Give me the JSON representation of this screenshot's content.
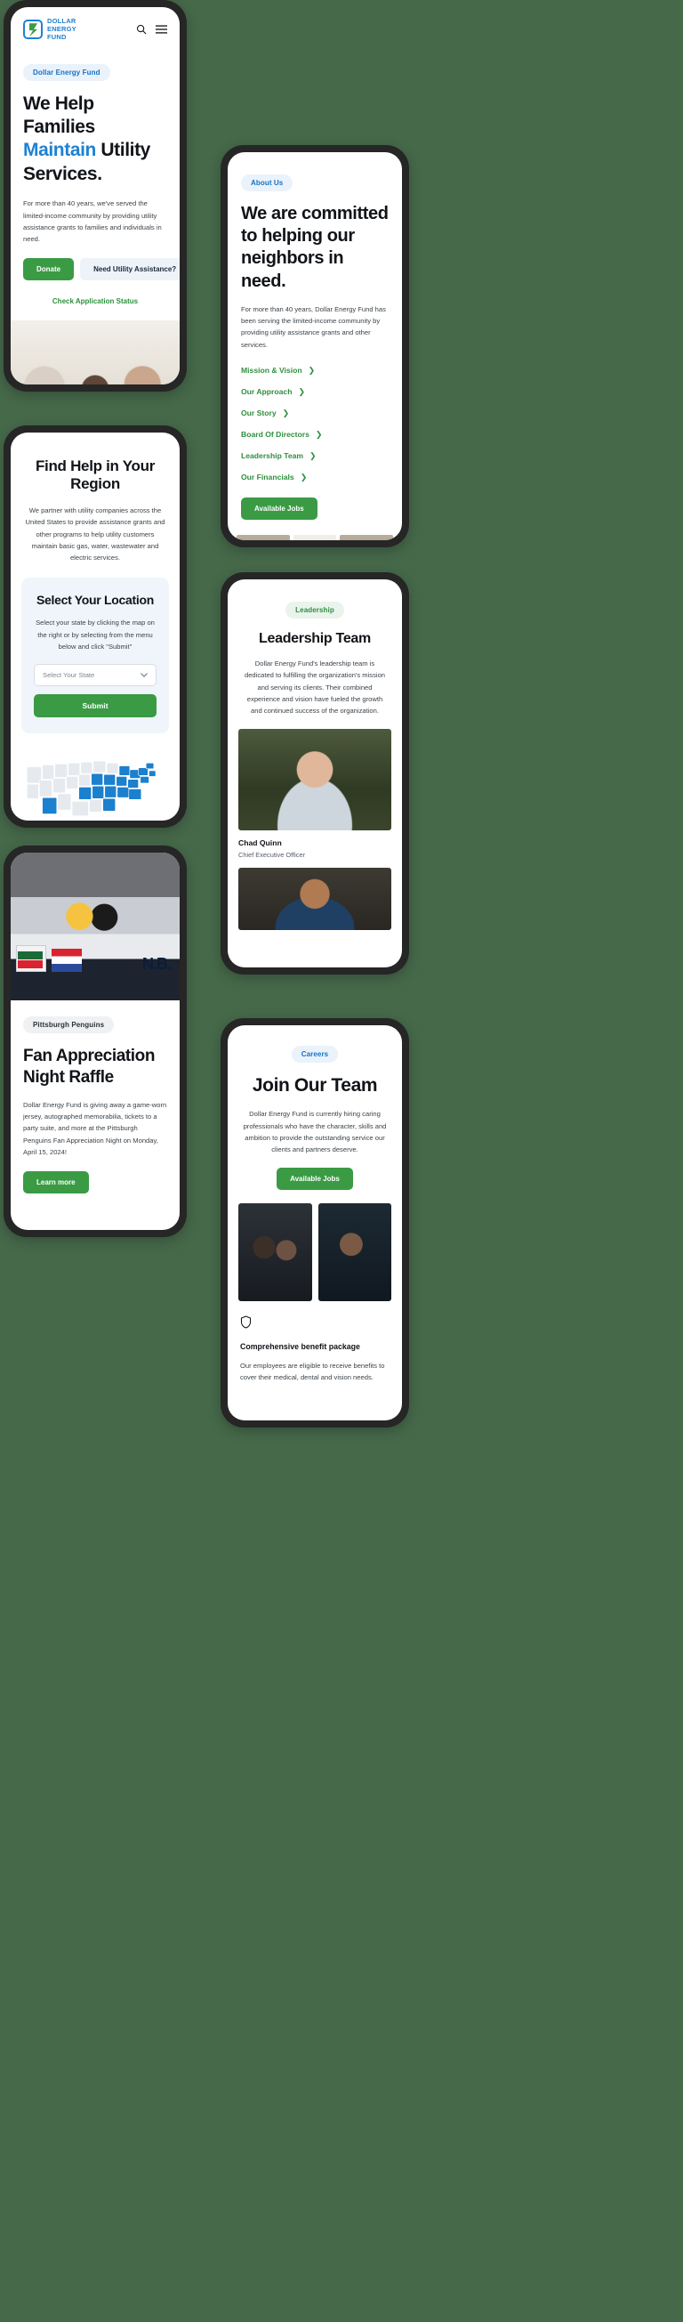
{
  "brand": {
    "name_lines": [
      "DOLLAR",
      "ENERGY",
      "FUND"
    ],
    "accent_blue": "#1e81d3",
    "accent_green": "#3a9b44",
    "page_background": "#46694a"
  },
  "header": {
    "search_icon": "search-icon",
    "menu_icon": "hamburger-menu-icon"
  },
  "home": {
    "badge": "Dollar Energy Fund",
    "heading_part1": "We Help Families ",
    "heading_accent": "Maintain",
    "heading_part2": " Utility Services.",
    "paragraph": "For more than 40 years, we've served the limited-income community by providing utility assistance grants to families and individuals in need.",
    "primary_button": "Donate",
    "secondary_button": "Need Utility Assistance?",
    "status_link": "Check Application Status",
    "photo": "family-in-bright-room-photo"
  },
  "region": {
    "heading": "Find Help in Your Region",
    "paragraph": "We partner with utility companies across the United States to provide assistance grants and other programs to help utility customers maintain basic gas, water, wastewater and electric services.",
    "location_box": {
      "heading": "Select Your Location",
      "instructions": "Select your state by clicking the map on the right or by selecting from the menu below and click \"Submit\"",
      "select_placeholder": "Select Your State",
      "select_value": "",
      "submit_label": "Submit"
    },
    "map_label": "united-states-service-area-map",
    "map_active_color": "#1b80ce",
    "map_inactive_color": "#e6eaef"
  },
  "raffle": {
    "photo": "pittsburgh-penguins-bench-photo",
    "badge": "Pittsburgh Penguins",
    "heading_line1": "Fan Appreciation",
    "heading_line2": "Night Raffle",
    "paragraph": "Dollar Energy Fund is giving away a game-worn jersey, autographed memorabilia, tickets to a party suite, and more at the Pittsburgh Penguins Fan Appreciation Night on Monday, April 15, 2024!",
    "button": "Learn more"
  },
  "about": {
    "badge": "About Us",
    "heading": "We are committed to helping our neighbors in need.",
    "paragraph": "For more than 40 years, Dollar Energy Fund has been serving the limited-income community by providing utility assistance grants and other services.",
    "links": [
      "Mission & Vision",
      "Our Approach",
      "Our Story",
      "Board Of Directors",
      "Leadership Team",
      "Our Financials"
    ],
    "button": "Available Jobs",
    "gallery": [
      "office-photo-1",
      "office-photo-2",
      "office-photo-3"
    ]
  },
  "leadership": {
    "badge": "Leadership",
    "heading": "Leadership Team",
    "paragraph": "Dollar Energy Fund's leadership team is dedicated to fulfilling the organization's mission and serving its clients. Their combined experience and vision have fueled the growth and continued success of the organization.",
    "members": [
      {
        "name": "Chad Quinn",
        "title": "Chief Executive Officer",
        "photo": "chad-quinn-portrait"
      },
      {
        "name": "",
        "title": "",
        "photo": "team-member-portrait-2"
      }
    ]
  },
  "careers": {
    "badge": "Careers",
    "heading": "Join Our Team",
    "paragraph": "Dollar Energy Fund is currently hiring caring professionals who have the character, skills and ambition to provide the outstanding service our clients and partners deserve.",
    "button": "Available Jobs",
    "photos": [
      "team-meeting-photo-1",
      "team-meeting-photo-2"
    ],
    "benefit": {
      "icon": "shield-icon",
      "title": "Comprehensive benefit package",
      "text": "Our employees are eligible to receive benefits to cover their medical, dental and vision needs."
    }
  }
}
